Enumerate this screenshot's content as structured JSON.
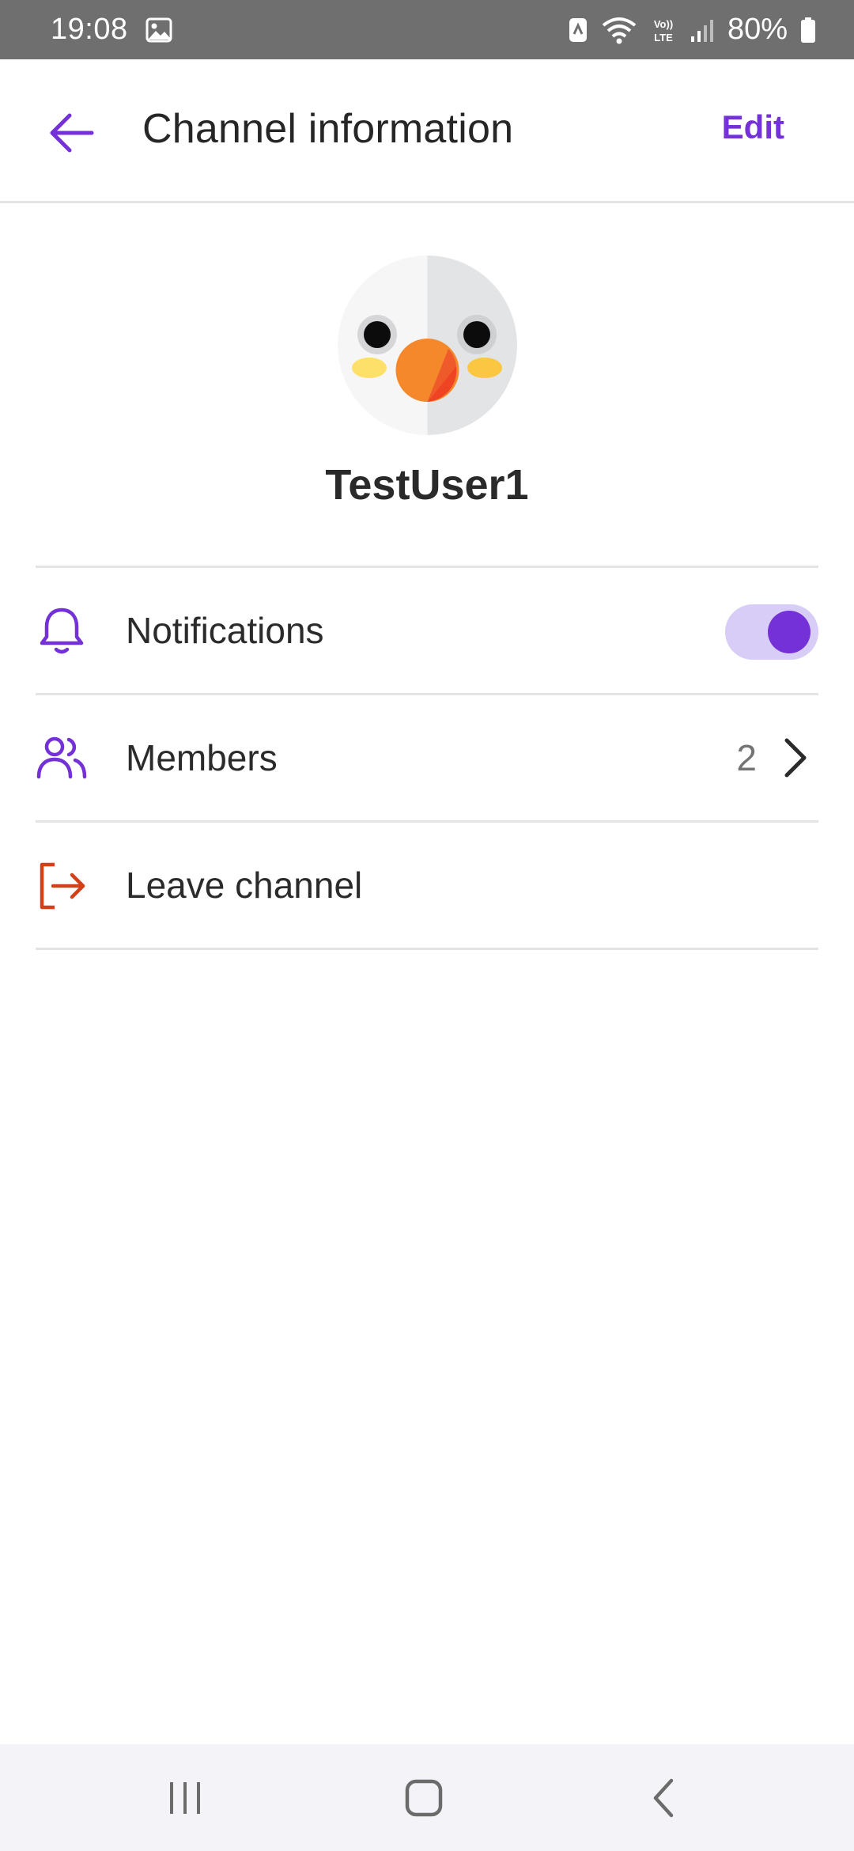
{
  "status_bar": {
    "time": "19:08",
    "battery": "80%",
    "icons": [
      "gallery-icon",
      "nfc-icon",
      "wifi-icon",
      "volte-icon",
      "signal-icon",
      "battery-icon"
    ]
  },
  "app_bar": {
    "title": "Channel information",
    "edit_label": "Edit",
    "back_icon": "arrow-left-icon"
  },
  "profile": {
    "name": "TestUser1",
    "avatar_icon": "bird-avatar-icon"
  },
  "menu": {
    "notifications": {
      "label": "Notifications",
      "icon": "bell-icon",
      "enabled": true
    },
    "members": {
      "label": "Members",
      "count": "2",
      "icon": "people-icon"
    },
    "leave": {
      "label": "Leave channel",
      "icon": "exit-icon"
    }
  },
  "colors": {
    "accent": "#7431d8",
    "accent_light": "#d7cdf6",
    "danger": "#d2401a",
    "status_bar": "#6f6f6f",
    "nav_bar": "#f4f4f8"
  },
  "nav_bar": {
    "buttons": [
      "recent-apps-icon",
      "home-icon",
      "back-icon"
    ]
  }
}
